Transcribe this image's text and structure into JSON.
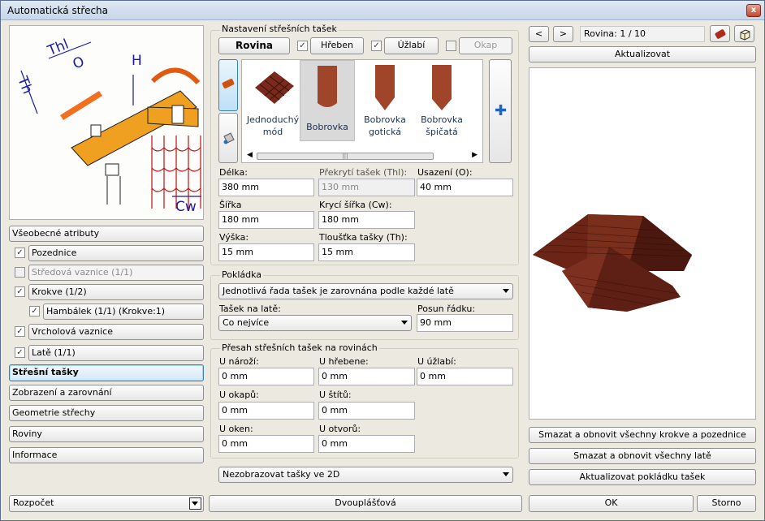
{
  "window": {
    "title": "Automatická střecha",
    "close": "x"
  },
  "left": {
    "diagram_labels": {
      "thl": "Thl",
      "o": "O",
      "th": "Th",
      "h": "H",
      "cw": "Cw"
    },
    "nav": [
      {
        "label": "Všeobecné atributy"
      },
      {
        "label": "Pozednice"
      },
      {
        "label": "Středová vaznice (1/1)"
      },
      {
        "label": "Krokve (1/2)"
      },
      {
        "label": "Hambálek (1/1) (Krokve:1)"
      },
      {
        "label": "Vrcholová vaznice"
      },
      {
        "label": "Latě (1/1)"
      },
      {
        "label": "Střešní tašky"
      },
      {
        "label": "Zobrazení a zarovnání"
      },
      {
        "label": "Geometrie střechy"
      },
      {
        "label": "Roviny"
      },
      {
        "label": "Informace"
      }
    ],
    "budget": "Rozpočet"
  },
  "settings": {
    "group_title": "Nastavení střešních tašek",
    "rovina": "Rovina",
    "hreben": "Hřeben",
    "uzlabi": "Úžlabí",
    "okap": "Okap",
    "tiles": [
      {
        "label": "Jednoduchý mód"
      },
      {
        "label": "Bobrovka"
      },
      {
        "label": "Bobrovka gotická"
      },
      {
        "label": "Bobrovka špičatá"
      }
    ],
    "scroll_grip": "|||",
    "delka": {
      "label": "Délka:",
      "value": "380 mm"
    },
    "prekryti": {
      "label": "Překrytí tašek (Thl):",
      "value": "130 mm"
    },
    "usazeni": {
      "label": "Usazení (O):",
      "value": "40 mm"
    },
    "sirka": {
      "label": "Šířka",
      "value": "180 mm"
    },
    "kryci": {
      "label": "Krycí šířka (Cw):",
      "value": "180 mm"
    },
    "vyska": {
      "label": "Výška:",
      "value": "15 mm"
    },
    "tloustka": {
      "label": "Tloušťka tašky (Th):",
      "value": "15 mm"
    }
  },
  "pokladka": {
    "title": "Pokládka",
    "mode": "Jednotlivá řada tašek je zarovnána podle každé latě",
    "tasek_label": "Tašek na latě:",
    "tasek_value": "Co nejvíce",
    "posun_label": "Posun řádku:",
    "posun_value": "90 mm"
  },
  "presah": {
    "title": "Přesah střešních tašek na rovinách",
    "fields": [
      {
        "label": "U nároží:",
        "value": "0 mm"
      },
      {
        "label": "U hřebene:",
        "value": "0 mm"
      },
      {
        "label": "U úžlabí:",
        "value": "0 mm"
      },
      {
        "label": "U okapů:",
        "value": "0 mm"
      },
      {
        "label": "U štítů:",
        "value": "0 mm"
      },
      {
        "label": "U oken:",
        "value": "0 mm"
      },
      {
        "label": "U otvorů:",
        "value": "0 mm"
      }
    ]
  },
  "display2d": "Nezobrazovat tašky ve 2D",
  "right": {
    "prev": "<",
    "next": ">",
    "rovina": "Rovina: 1 / 10",
    "aktualizovat": "Aktualizovat",
    "b1": "Smazat a obnovit všechny krokve a pozednice",
    "b2": "Smazat a obnovit všechny latě",
    "b3": "Aktualizovat pokládku tašek"
  },
  "footer": {
    "dvouplastova": "Dvouplášťová",
    "ok": "OK",
    "storno": "Storno"
  },
  "colors": {
    "roof": "#7a2e1c",
    "tile": "#a0442a",
    "accent": "#3c7fb1"
  }
}
